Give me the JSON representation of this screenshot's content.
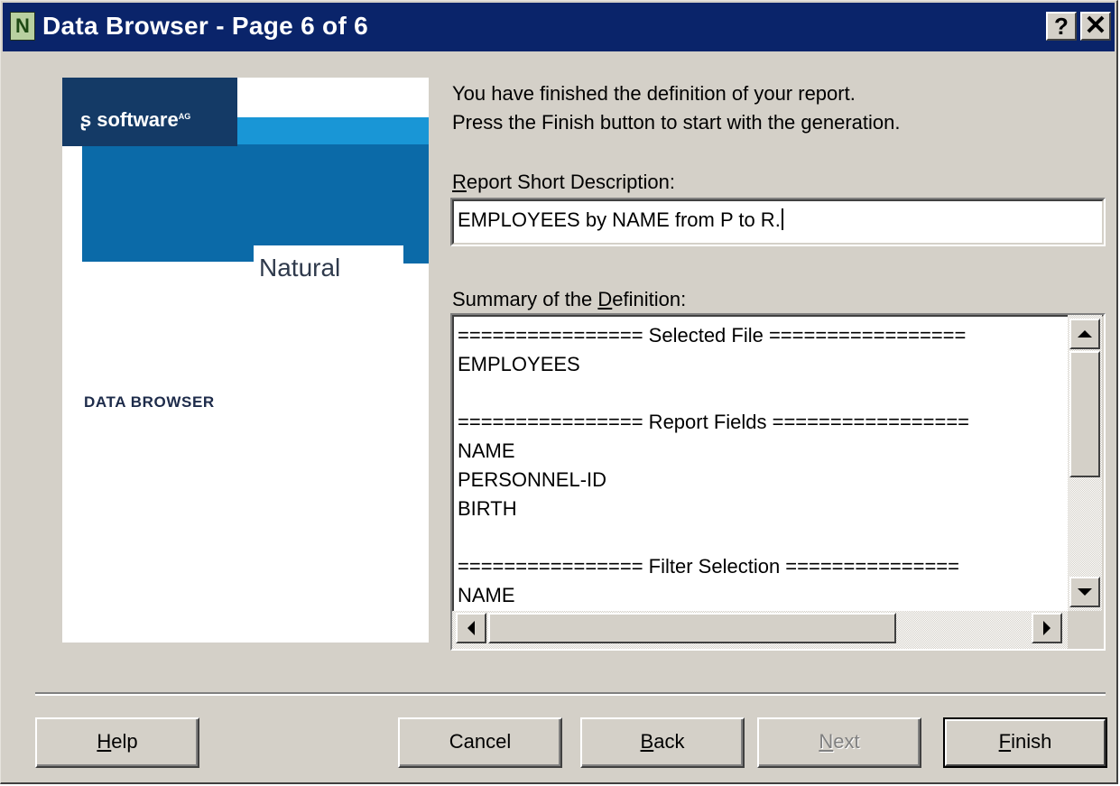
{
  "window": {
    "title": "Data Browser - Page 6 of 6",
    "icon_letter": "N",
    "help_glyph": "?",
    "close_glyph": "✕"
  },
  "banner": {
    "company_logo": "software",
    "company_suffix": "AG",
    "product_name": "Natural",
    "module_name": "DATA BROWSER"
  },
  "intro": {
    "line1": "You have finished the definition of your report.",
    "line2": "Press the Finish button to start with the generation."
  },
  "description": {
    "label_mnemonic": "R",
    "label_rest": "eport Short Description:",
    "value": "EMPLOYEES by NAME from P to R."
  },
  "summary": {
    "label_before": "Summary of the ",
    "label_mnemonic": "D",
    "label_after": "efinition:",
    "lines": [
      "================ Selected File =================",
      "EMPLOYEES",
      "",
      "================ Report Fields =================",
      "NAME",
      "PERSONNEL-ID",
      "BIRTH",
      "",
      "================ Filter Selection ===============",
      "NAME"
    ]
  },
  "buttons": {
    "help": {
      "mnemonic": "H",
      "rest": "elp"
    },
    "cancel": {
      "label": "Cancel"
    },
    "back": {
      "mnemonic": "B",
      "rest": "ack"
    },
    "next": {
      "mnemonic": "N",
      "rest": "ext",
      "enabled": false
    },
    "finish": {
      "mnemonic": "F",
      "rest": "inish",
      "default": true
    }
  },
  "colors": {
    "title_bar": "#0a246a",
    "dialog_face": "#d4d0c8",
    "banner_navy": "#143a66",
    "banner_blue": "#0b6aa8",
    "banner_cyan": "#1996d6"
  }
}
